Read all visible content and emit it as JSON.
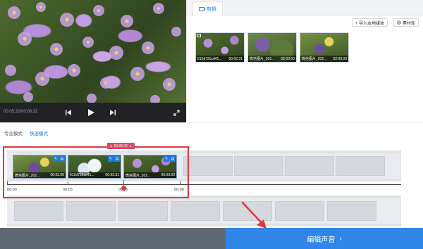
{
  "player": {
    "time": "00:05.32/00:08.32",
    "prev_icon": "skip-previous-icon",
    "play_icon": "play-icon",
    "next_icon": "skip-next-icon",
    "fullscreen_icon": "fullscreen-icon"
  },
  "library": {
    "tab_label": "剪辑",
    "import_label": "+ 导入本地媒体",
    "material_label": "素材库",
    "items": [
      {
        "name": "612d731cd41...",
        "duration": "00:02.31",
        "is_video": true
      },
      {
        "name": "微信图片_202...",
        "duration": "02:00.00",
        "is_video": false
      },
      {
        "name": "微信图片_202...",
        "duration": "02:00.00",
        "is_video": false
      }
    ]
  },
  "modes": {
    "pro": "专业模式",
    "separator": "|",
    "fast": "快速模式"
  },
  "timeline": {
    "selection_label": "00:05.32",
    "clips": [
      {
        "name": "微信图片_202...",
        "duration": "00:03.00"
      },
      {
        "name": "612d731cd41...",
        "duration": "00:02.31"
      },
      {
        "name": "微信图片_202...",
        "duration": "00:03.00"
      }
    ],
    "ticks": [
      "00:00",
      "00:03",
      "00:05",
      "00:08"
    ]
  },
  "bottom": {
    "action_label": "编辑声音",
    "chevron": "›"
  },
  "colors": {
    "accent": "#2f86e6",
    "highlight": "#e2373f"
  }
}
